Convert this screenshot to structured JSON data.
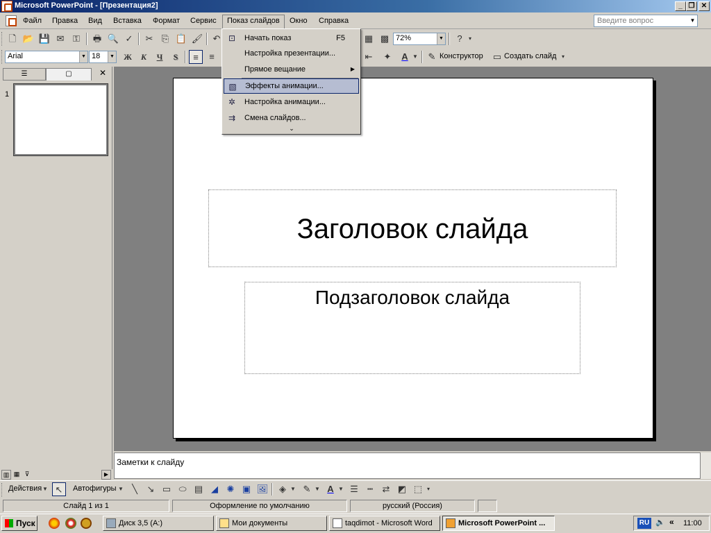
{
  "window": {
    "title": "Microsoft PowerPoint - [Презентация2]",
    "min_glyph": "_",
    "restore_glyph": "❐",
    "close_glyph": "✕"
  },
  "menubar": {
    "items": [
      "Файл",
      "Правка",
      "Вид",
      "Вставка",
      "Формат",
      "Сервис",
      "Показ слайдов",
      "Окно",
      "Справка"
    ],
    "help_placeholder": "Введите вопрос"
  },
  "slideshow_menu": {
    "items": [
      {
        "label": "Начать показ",
        "shortcut": "F5",
        "icon": "projector-icon"
      },
      {
        "label": "Настройка презентации...",
        "icon": ""
      },
      {
        "label": "Прямое вещание",
        "icon": "",
        "submenu": true
      },
      {
        "label": "Эффекты анимации...",
        "icon": "animation-effects-icon",
        "highlighted": true
      },
      {
        "label": "Настройка анимации...",
        "icon": "custom-animation-icon"
      },
      {
        "label": "Смена слайдов...",
        "icon": "slide-transition-icon"
      }
    ],
    "expand_glyph": "⌄"
  },
  "standard_toolbar": {
    "zoom": "72%"
  },
  "format_toolbar": {
    "font": "Arial",
    "size": "18",
    "bold": "Ж",
    "italic": "К",
    "underline": "Ч",
    "shadow": "S",
    "designer_label": "Конструктор",
    "new_slide_label": "Создать слайд"
  },
  "left_pane": {
    "slide_number": "1",
    "close_glyph": "✕"
  },
  "slide": {
    "title": "Заголовок слайда",
    "subtitle": "Подзаголовок слайда"
  },
  "notes": {
    "placeholder": "Заметки к слайду"
  },
  "drawing_toolbar": {
    "actions_label": "Действия",
    "autoshapes_label": "Автофигуры"
  },
  "statusbar": {
    "slide_info": "Слайд 1 из 1",
    "design": "Оформление по умолчанию",
    "language": "русский (Россия)"
  },
  "taskbar": {
    "start": "Пуск",
    "tasks": [
      "Диск 3,5 (A:)",
      "Мои документы",
      "taqdimot - Microsoft Word",
      "Microsoft PowerPoint ..."
    ],
    "lang": "RU",
    "time": "11:00",
    "tray_glyph": "«"
  }
}
